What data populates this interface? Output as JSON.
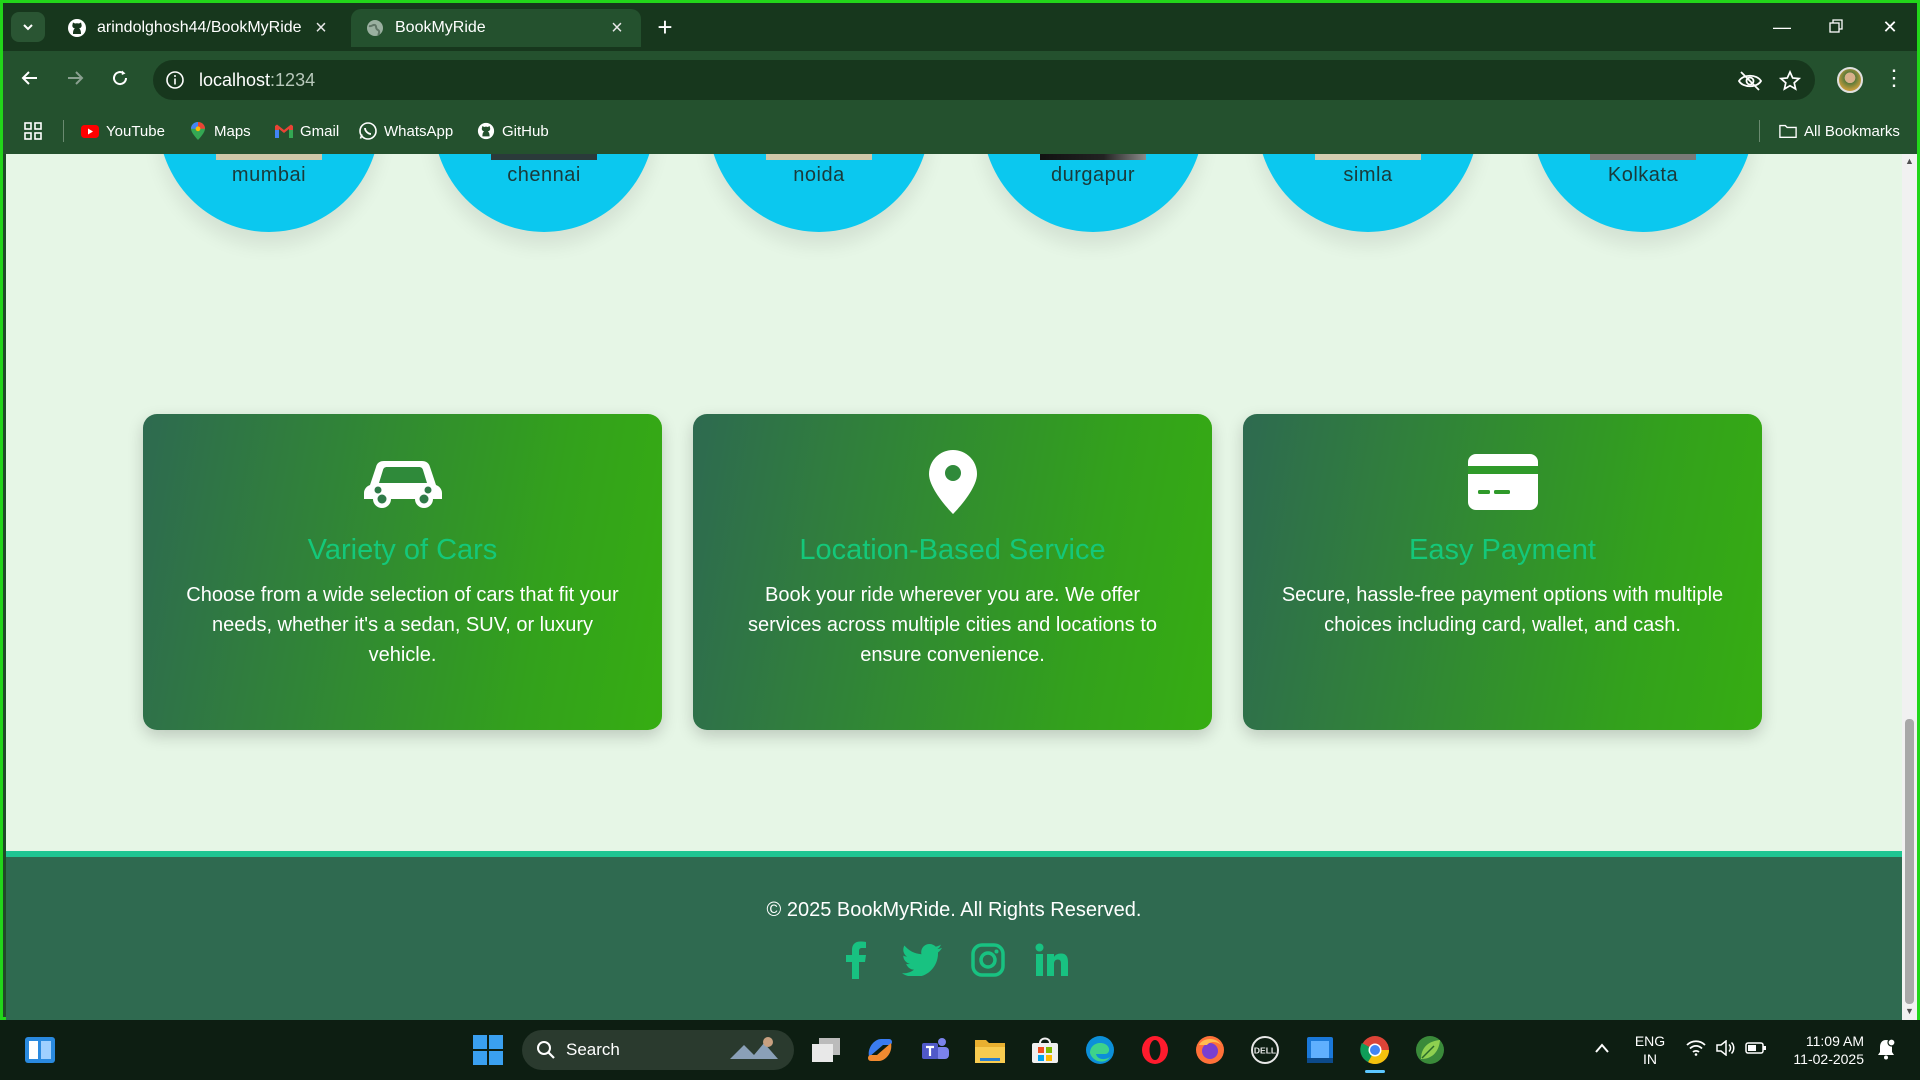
{
  "browser": {
    "tabs": [
      {
        "label": "arindolghosh44/BookMyRide",
        "icon": "github-icon"
      },
      {
        "label": "BookMyRide",
        "icon": "globe-icon"
      }
    ],
    "address": {
      "host": "localhost",
      "port": ":1234"
    },
    "bookmarks": [
      "YouTube",
      "Maps",
      "Gmail",
      "WhatsApp",
      "GitHub"
    ],
    "all_bookmarks": "All Bookmarks"
  },
  "cities": [
    "mumbai",
    "chennai",
    "noida",
    "durgapur",
    "simla",
    "Kolkata"
  ],
  "features": [
    {
      "icon": "car-icon",
      "title": "Variety of Cars",
      "description": "Choose from a wide selection of cars that fit your needs, whether it's a sedan, SUV, or luxury vehicle."
    },
    {
      "icon": "location-pin-icon",
      "title": "Location-Based Service",
      "description": "Book your ride wherever you are. We offer services across multiple cities and locations to ensure convenience."
    },
    {
      "icon": "credit-card-icon",
      "title": "Easy Payment",
      "description": "Secure, hassle-free payment options with multiple choices including card, wallet, and cash."
    }
  ],
  "footer": {
    "copyright": "© 2025 BookMyRide. All Rights Reserved.",
    "socials": [
      "facebook-icon",
      "twitter-icon",
      "instagram-icon",
      "linkedin-icon"
    ]
  },
  "taskbar": {
    "search_label": "Search",
    "lang_top": "ENG",
    "lang_bottom": "IN",
    "time": "11:09 AM",
    "date": "11-02-2025"
  },
  "colors": {
    "accent_title": "#14c87a",
    "city_circle": "#0bc8ef",
    "footer_bg": "#2f6a50",
    "page_bg": "#e6f6e6"
  }
}
